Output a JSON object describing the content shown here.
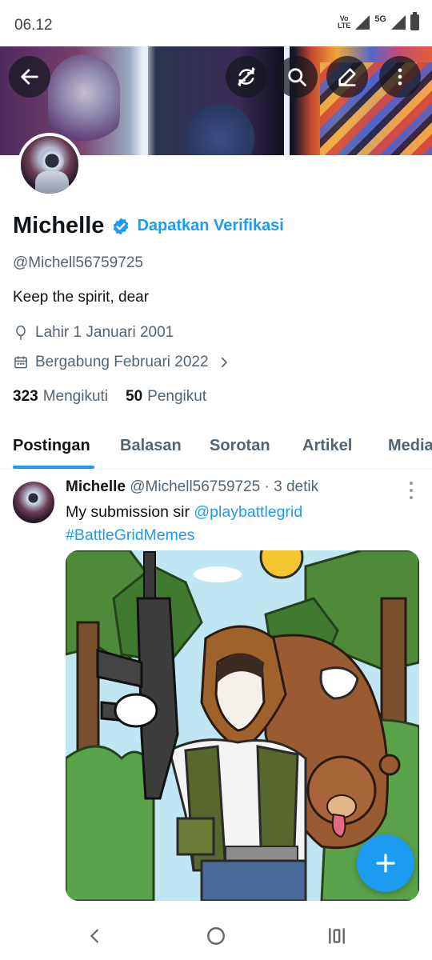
{
  "status_bar": {
    "time": "06.12",
    "network_lte": "Vo LTE",
    "network_5g": "5G"
  },
  "header": {
    "back_icon": "arrow-left-icon",
    "actions": [
      "refresh-icon",
      "search-icon",
      "edit-icon",
      "more-vertical-icon"
    ]
  },
  "profile": {
    "name": "Michelle",
    "verify_link": "Dapatkan Verifikasi",
    "handle": "@Michell56759725",
    "bio": "Keep the spirit, dear",
    "birthday": "Lahir 1 Januari 2001",
    "joined": "Bergabung Februari 2022",
    "following_count": "323",
    "following_label": "Mengikuti",
    "followers_count": "50",
    "followers_label": "Pengikut",
    "accent_color": "#1d9bf0"
  },
  "tabs": [
    {
      "label": "Postingan",
      "active": true
    },
    {
      "label": "Balasan",
      "active": false
    },
    {
      "label": "Sorotan",
      "active": false
    },
    {
      "label": "Artikel",
      "active": false
    },
    {
      "label": "Media",
      "active": false
    }
  ],
  "post": {
    "author": "Michelle",
    "handle": "@Michell56759725",
    "separator": "·",
    "time": "3 detik",
    "text_prefix": "My submission sir ",
    "mention": "@playbattlegrid",
    "hashtag": "#BattleGridMemes"
  },
  "fab": {
    "icon": "plus-icon"
  },
  "nav_bar": {
    "icons": [
      "back-chevron-icon",
      "home-circle-icon",
      "recents-icon"
    ]
  }
}
